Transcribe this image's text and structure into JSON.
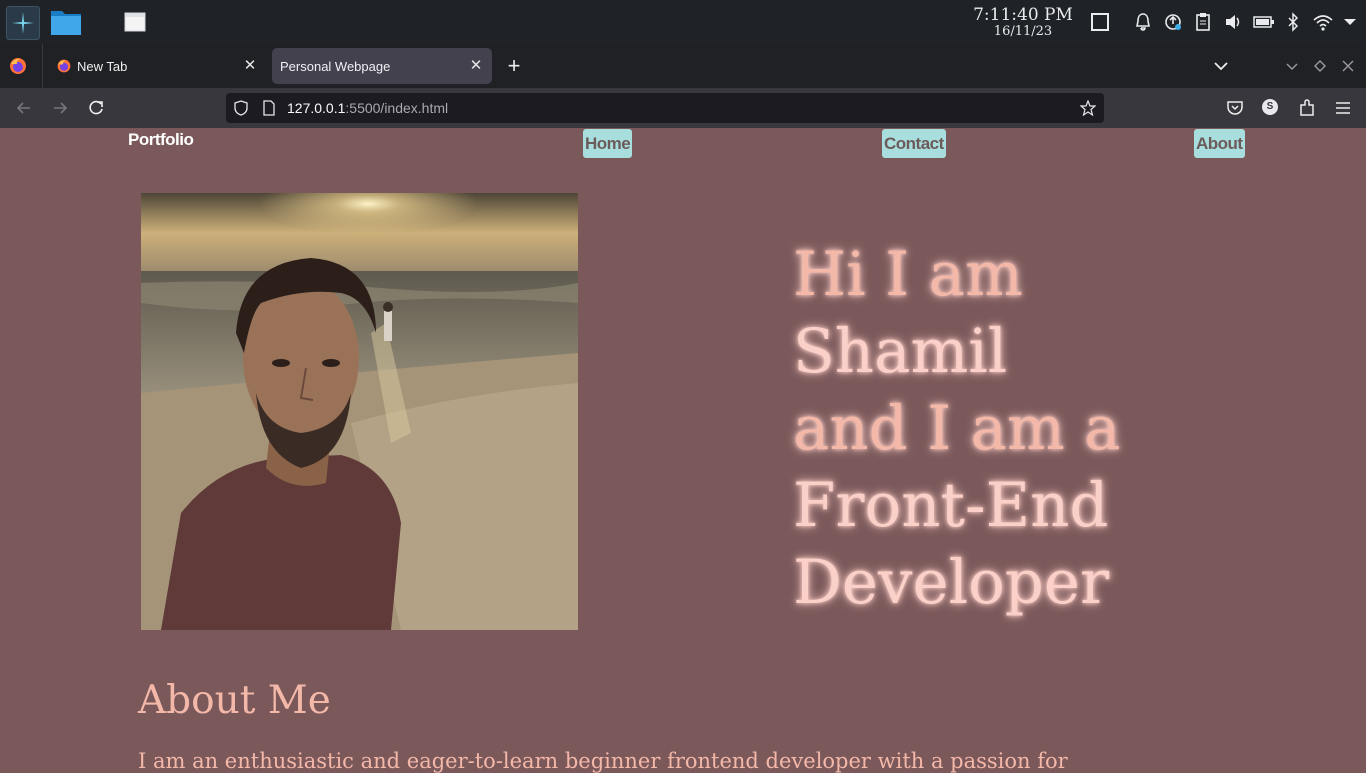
{
  "taskbar": {
    "clock_time": "7:11:40 PM",
    "clock_date": "16/11/23"
  },
  "tabs": [
    {
      "title": "New Tab",
      "active": false
    },
    {
      "title": "Personal Webpage",
      "active": true
    }
  ],
  "urlbar": {
    "host": "127.0.0.1",
    "rest": ":5500/index.html"
  },
  "profile_initial": "S",
  "site": {
    "brand": "Portfolio",
    "nav": [
      {
        "label": "Home"
      },
      {
        "label": "Contact"
      },
      {
        "label": "About"
      }
    ],
    "hero": {
      "line1": "Hi I am",
      "line2": "Shamil",
      "line3": "and I am a",
      "line4": "Front-End",
      "line5": "Developer"
    },
    "about": {
      "title": "About Me",
      "text": "I am an enthusiastic and eager-to-learn beginner frontend developer with a passion for"
    }
  },
  "colors": {
    "page_bg": "#7b585a",
    "nav_button_bg": "#a8dedd",
    "hero_text": "#f4b8a9",
    "taskbar_bg": "#1f2227",
    "browser_chrome": "#38373e"
  }
}
